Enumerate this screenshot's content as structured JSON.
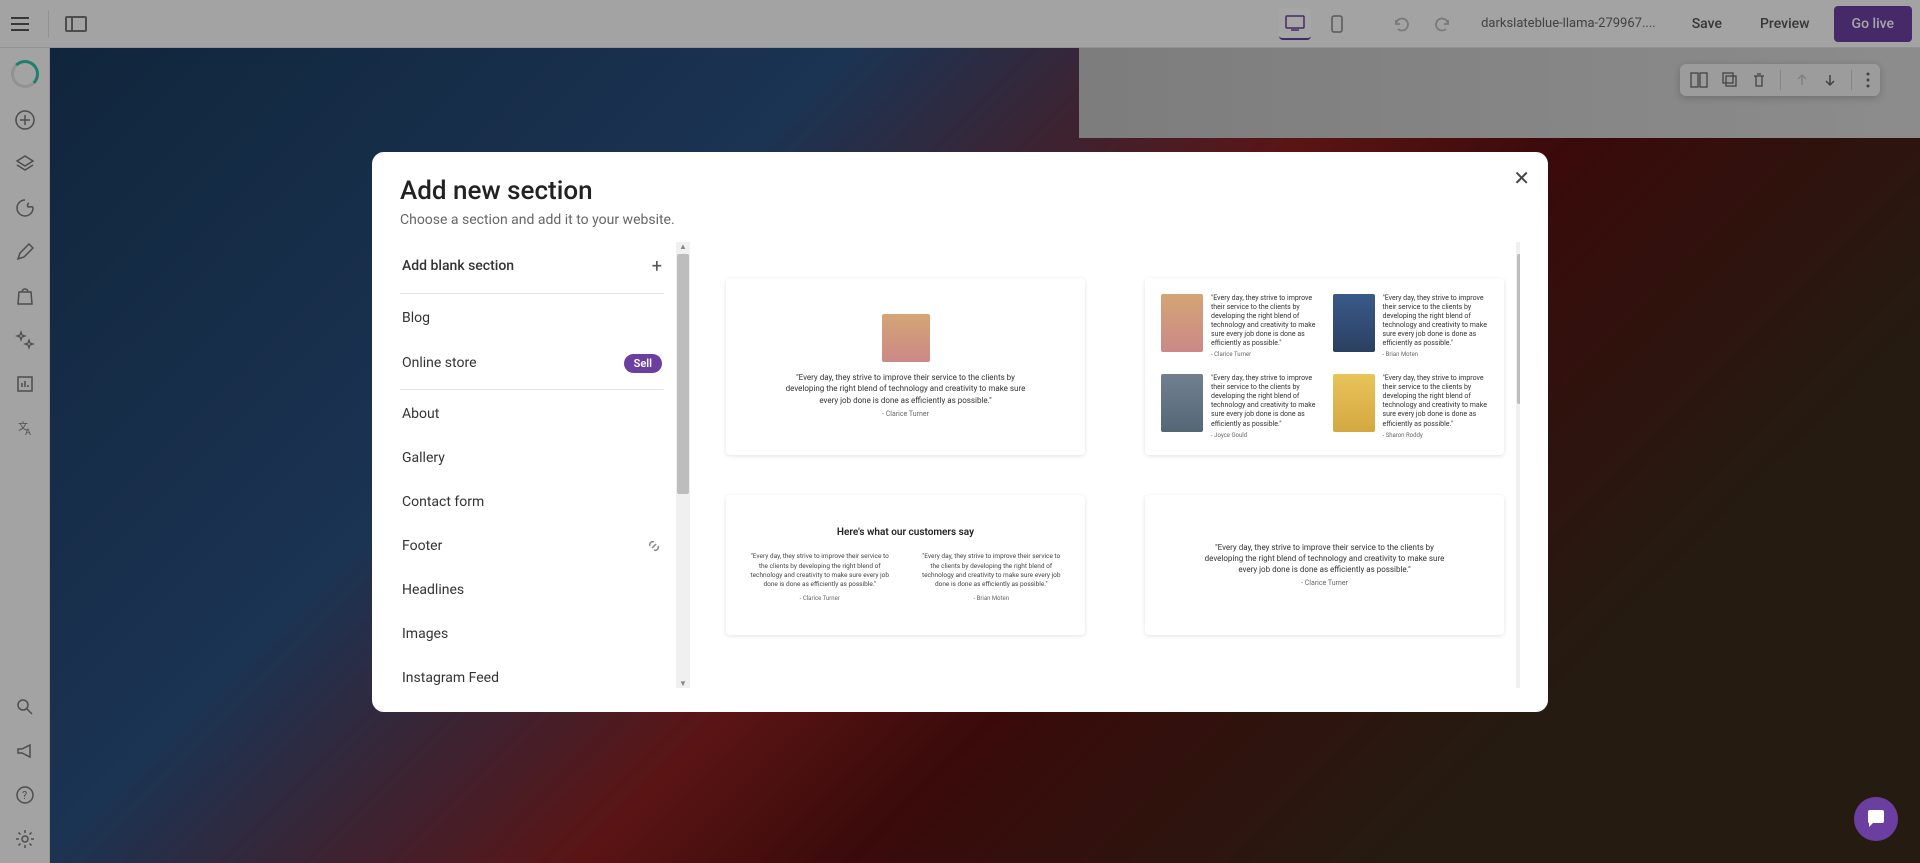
{
  "toolbar": {
    "url": "darkslateblue-llama-279967....",
    "save": "Save",
    "preview": "Preview",
    "go_live": "Go live"
  },
  "modal": {
    "title": "Add new section",
    "subtitle": "Choose a section and add it to your website.",
    "categories": {
      "blank": "Add blank section",
      "blog": "Blog",
      "store": "Online store",
      "store_badge": "Sell",
      "about": "About",
      "gallery": "Gallery",
      "contact": "Contact form",
      "footer": "Footer",
      "headlines": "Headlines",
      "images": "Images",
      "instagram": "Instagram Feed"
    },
    "templates": {
      "quote": "\"Every day, they strive to improve their service to the clients by developing the right blend of technology and creativity to make sure every job done is done as efficiently as possible.\"",
      "author1": "- Clarice Turner",
      "author2": "- Brian Moten",
      "author3": "- Joyce Gould",
      "author4": "- Sharon Roddy",
      "t3_title": "Here's what our customers say"
    }
  }
}
